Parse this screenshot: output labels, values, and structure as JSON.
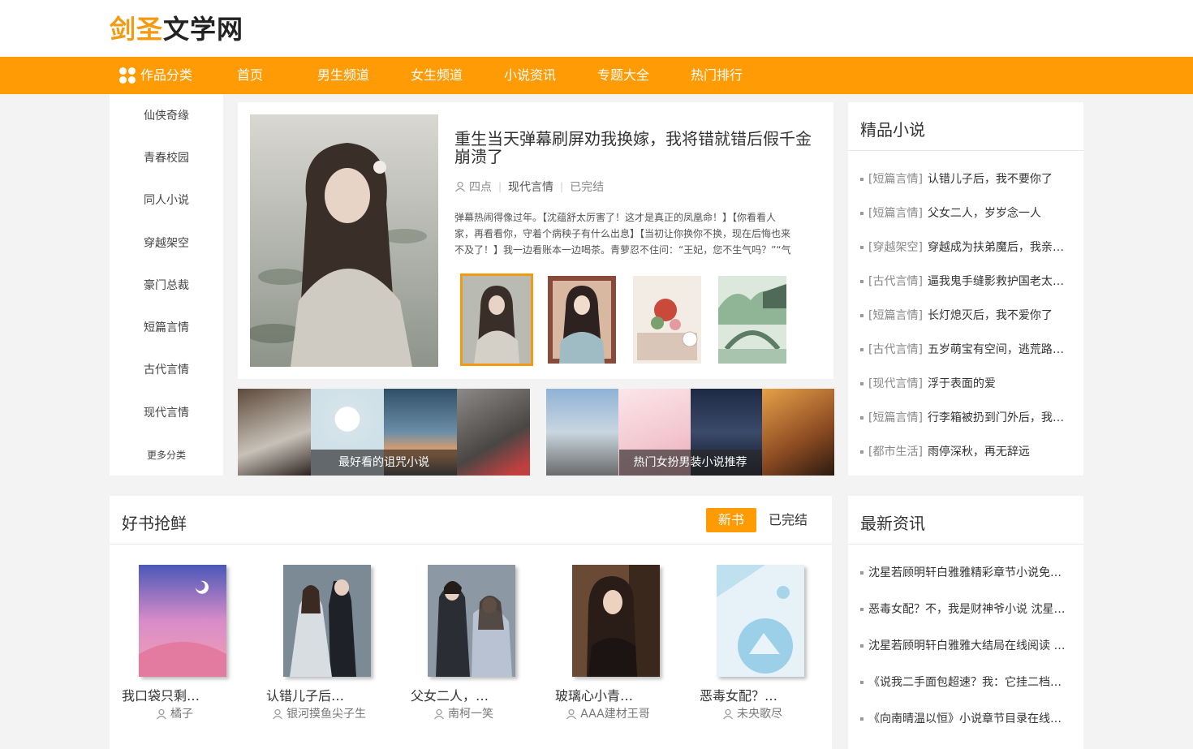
{
  "site": {
    "logo_part1": "剑圣",
    "logo_part2": "文学网",
    "accent_color": "#ff9b05"
  },
  "nav": {
    "category_label": "作品分类",
    "items": [
      "首页",
      "男生频道",
      "女生频道",
      "小说资讯",
      "专题大全",
      "热门排行"
    ]
  },
  "sidebar": {
    "items": [
      "仙侠奇缘",
      "青春校园",
      "同人小说",
      "穿越架空",
      "豪门总裁",
      "短篇言情",
      "古代言情",
      "现代言情"
    ],
    "more": "更多分类"
  },
  "featured": {
    "title": "重生当天弹幕刷屏劝我换嫁，我将错就错后假千金崩溃了",
    "author": "四点",
    "genre": "现代言情",
    "status": "已完结",
    "description": "弹幕热闹得像过年。【沈蕴舒太厉害了！这才是真正的凤凰命！】【你看看人家，再看看你，守着个病秧子有什么出息】【当初让你换你不换，现在后悔也来不及了！】我一边看账本一边喝茶。青萝忍不住问：“王妃，您不生气吗？”“气"
  },
  "banners": [
    {
      "caption": "最好看的诅咒小说"
    },
    {
      "caption": "热门女扮男装小说推荐"
    }
  ],
  "premium": {
    "title": "精品小说",
    "items": [
      {
        "tag": "[短篇言情]",
        "name": "认错儿子后，我不要你了"
      },
      {
        "tag": "[短篇言情]",
        "name": "父女二人，岁岁念一人"
      },
      {
        "tag": "[穿越架空]",
        "name": "穿越成为扶弟魔后，我亲手送弟弟去改造"
      },
      {
        "tag": "[古代言情]",
        "name": "逼我鬼手缝影救护国老太君，我反手送他们全家"
      },
      {
        "tag": "[短篇言情]",
        "name": "长灯熄灭后，我不爱你了"
      },
      {
        "tag": "[古代言情]",
        "name": "五岁萌宝有空间，逃荒路上养全家"
      },
      {
        "tag": "[现代言情]",
        "name": "浮于表面的爱"
      },
      {
        "tag": "[短篇言情]",
        "name": "行李箱被扔到门外后，我转身离开"
      },
      {
        "tag": "[都市生活]",
        "name": "雨停深秋，再无辞远"
      }
    ]
  },
  "good_books": {
    "title": "好书抢鲜",
    "tab_new": "新书",
    "tab_done": "已完结",
    "books": [
      {
        "name": "我口袋只剩…",
        "author": "橘子"
      },
      {
        "name": "认错儿子后…",
        "author": "银河摸鱼尖子生"
      },
      {
        "name": "父女二人，…",
        "author": "南柯一笑"
      },
      {
        "name": "玻璃心小青…",
        "author": "AAA建材王哥"
      },
      {
        "name": "恶毒女配？…",
        "author": "未央歌尽"
      }
    ]
  },
  "news": {
    "title": "最新资讯",
    "items": [
      "沈星若顾明轩白雅雅精彩章节小说免费阅读",
      "恶毒女配？不，我是财神爷小说 沈星若顾明轩",
      "沈星若顾明轩白雅雅大结局在线阅读 全文免费",
      "《说我二手面包超速？我：它挂二档》小说章节",
      "《向南晴温以恒》小说章节目录在线阅读"
    ]
  }
}
